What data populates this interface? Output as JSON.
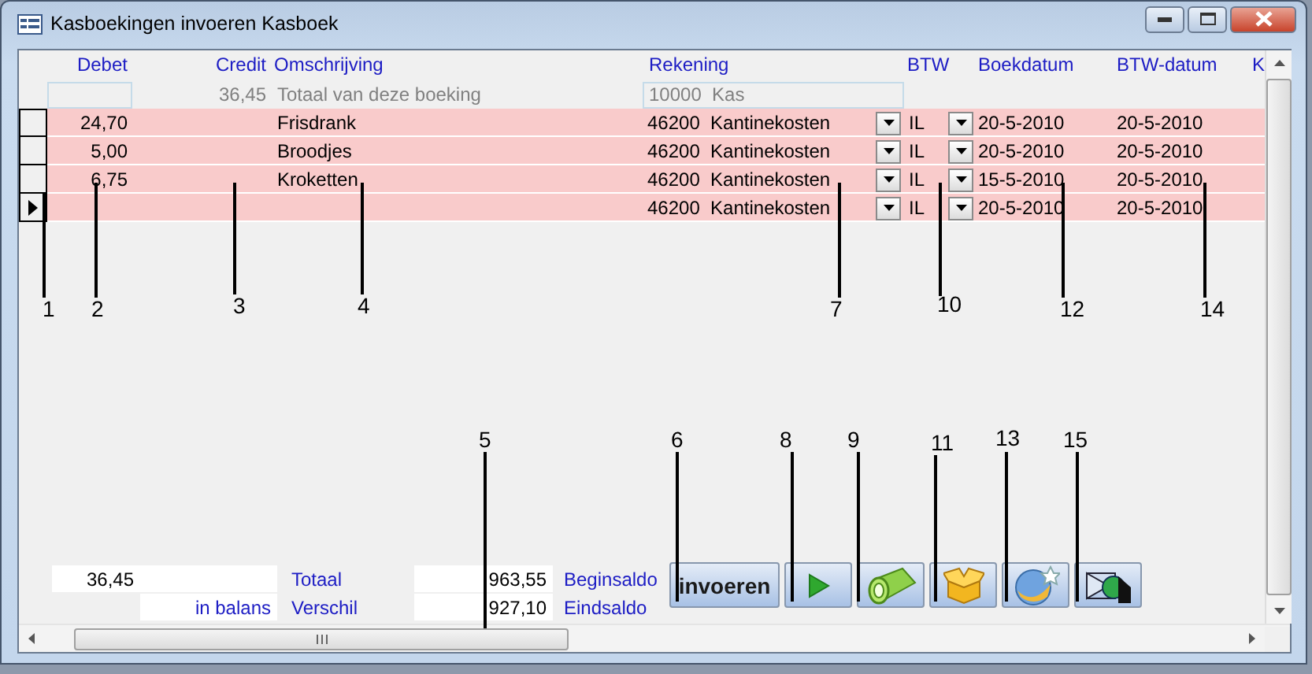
{
  "window": {
    "title": "Kasboekingen invoeren Kasboek"
  },
  "columns": [
    "Debet",
    "Credit",
    "Omschrijving",
    "Rekening",
    "BTW",
    "Boekdatum",
    "BTW-datum",
    "K"
  ],
  "total_row": {
    "credit": "36,45",
    "description": "Totaal van deze boeking",
    "account_number": "10000",
    "account_name": "Kas"
  },
  "rows": [
    {
      "selected": false,
      "debet": "24,70",
      "description": "Frisdrank",
      "account_number": "46200",
      "account_name": "Kantinekosten",
      "btw": "IL",
      "boekdatum": "20-5-2010",
      "btw_datum": "20-5-2010"
    },
    {
      "selected": false,
      "debet": "5,00",
      "description": "Broodjes",
      "account_number": "46200",
      "account_name": "Kantinekosten",
      "btw": "IL",
      "boekdatum": "20-5-2010",
      "btw_datum": "20-5-2010"
    },
    {
      "selected": false,
      "debet": "6,75",
      "description": "Kroketten",
      "account_number": "46200",
      "account_name": "Kantinekosten",
      "btw": "IL",
      "boekdatum": "15-5-2010",
      "btw_datum": "20-5-2010"
    },
    {
      "selected": true,
      "debet": "",
      "description": "",
      "account_number": "46200",
      "account_name": "Kantinekosten",
      "btw": "IL",
      "boekdatum": "20-5-2010",
      "btw_datum": "20-5-2010"
    }
  ],
  "footer": {
    "total_debet": "36,45",
    "total_label": "Totaal",
    "balance_status": "in balans",
    "difference_label": "Verschil",
    "begin_balance": "963,55",
    "begin_label": "Beginsaldo",
    "end_balance": "927,10",
    "end_label": "Eindsaldo"
  },
  "buttons": [
    {
      "kind": "text",
      "label": "invoeren"
    },
    {
      "kind": "play"
    },
    {
      "kind": "flashlight"
    },
    {
      "kind": "box"
    },
    {
      "kind": "globe"
    },
    {
      "kind": "exit"
    }
  ],
  "callouts": [
    {
      "label": "1"
    },
    {
      "label": "2"
    },
    {
      "label": "3"
    },
    {
      "label": "4"
    },
    {
      "label": "7"
    },
    {
      "label": "10"
    },
    {
      "label": "12"
    },
    {
      "label": "14"
    },
    {
      "label": "5"
    },
    {
      "label": "6"
    },
    {
      "label": "8"
    },
    {
      "label": "9"
    },
    {
      "label": "11"
    },
    {
      "label": "13"
    },
    {
      "label": "15"
    }
  ]
}
